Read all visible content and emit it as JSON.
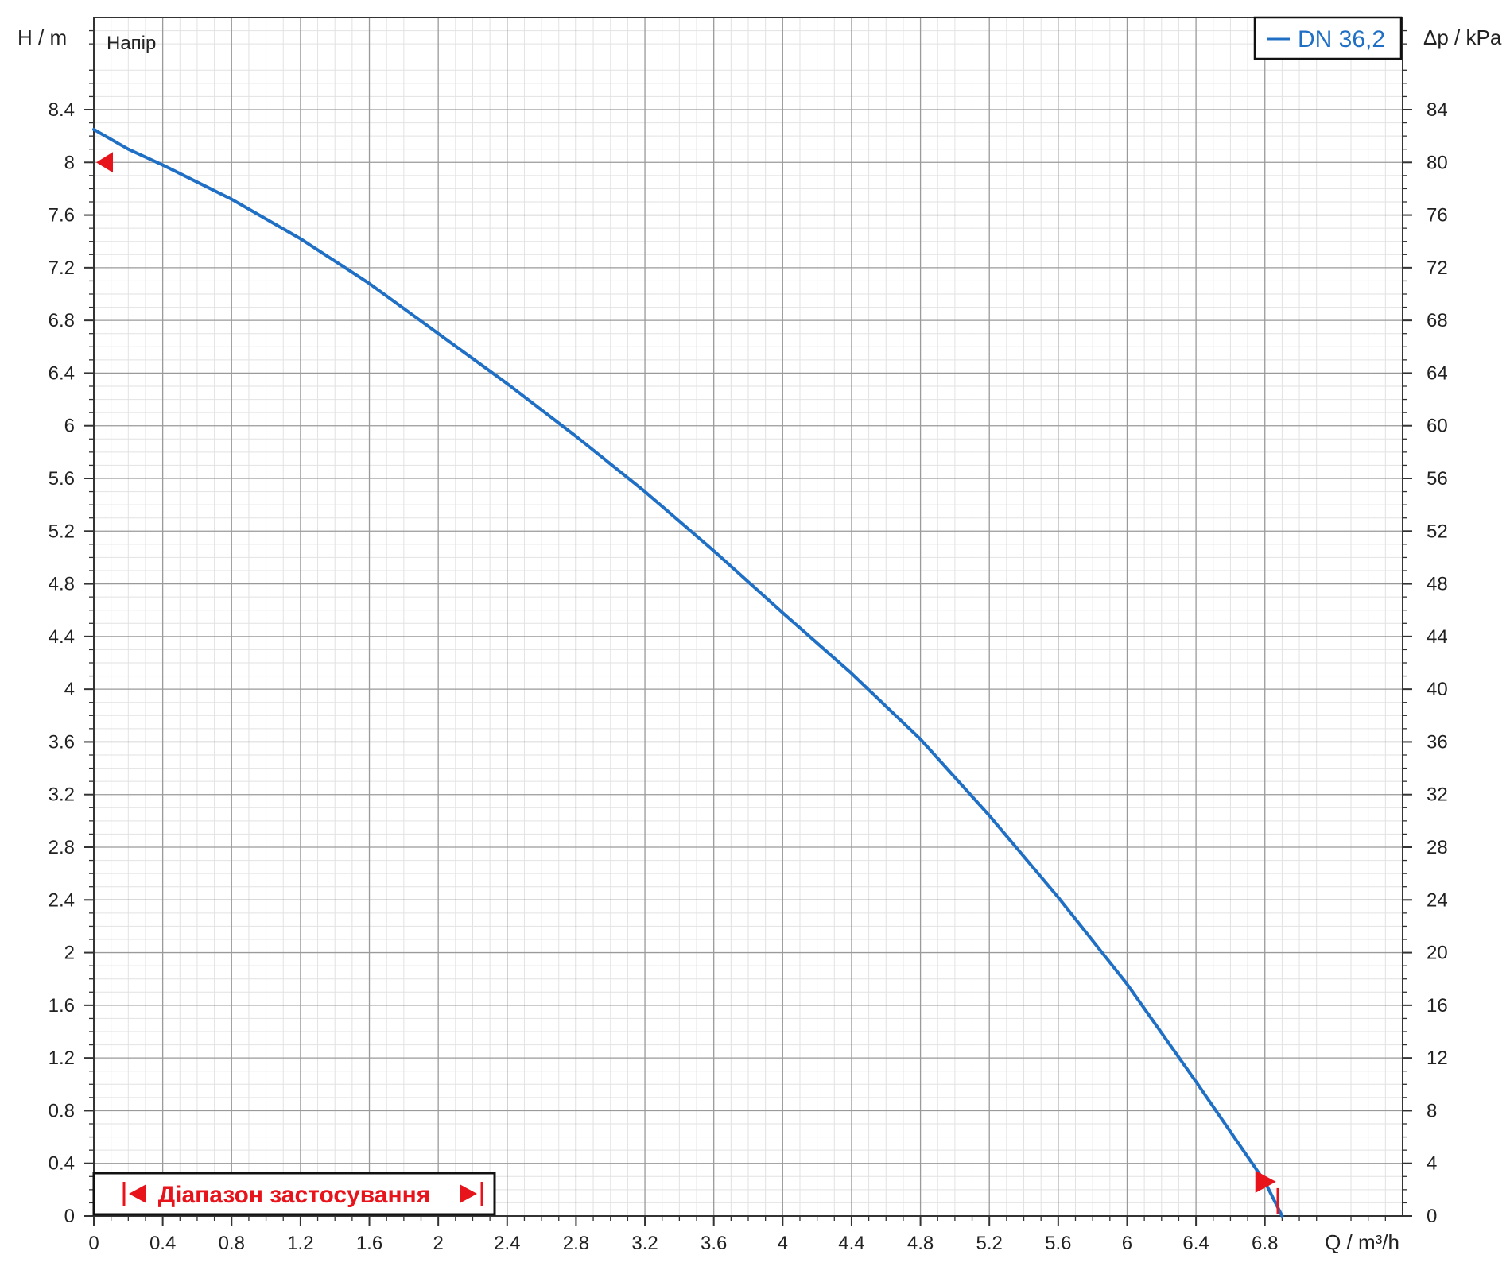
{
  "chart_data": {
    "type": "line",
    "title": "Напір",
    "xlabel": "Q / m³/h",
    "ylabel": "H / m",
    "y2label": "Δp / kPa",
    "xlim": [
      0,
      7.6
    ],
    "ylim": [
      0,
      9.1
    ],
    "y2lim": [
      0,
      91
    ],
    "x_ticks": [
      "0",
      "0.4",
      "0.8",
      "1.2",
      "1.6",
      "2",
      "2.4",
      "2.8",
      "3.2",
      "3.6",
      "4",
      "4.4",
      "4.8",
      "5.2",
      "5.6",
      "6",
      "6.4",
      "6.8"
    ],
    "y_ticks": [
      "0",
      "0.4",
      "0.8",
      "1.2",
      "1.6",
      "2",
      "2.4",
      "2.8",
      "3.2",
      "3.6",
      "4",
      "4.4",
      "4.8",
      "5.2",
      "5.6",
      "6",
      "6.4",
      "6.8",
      "7.2",
      "7.6",
      "8",
      "8.4"
    ],
    "y2_ticks": [
      "0",
      "4",
      "8",
      "12",
      "16",
      "20",
      "24",
      "28",
      "32",
      "36",
      "40",
      "44",
      "48",
      "52",
      "56",
      "60",
      "64",
      "68",
      "72",
      "76",
      "80",
      "84"
    ],
    "grid": true,
    "legend_position": "top-right",
    "series": [
      {
        "name": "DN 36,2",
        "color": "#1f6fc5",
        "x": [
          0,
          0.2,
          0.4,
          0.8,
          1.2,
          1.6,
          2.0,
          2.4,
          2.8,
          3.2,
          3.6,
          4.0,
          4.4,
          4.8,
          5.2,
          5.6,
          6.0,
          6.4,
          6.8,
          6.9
        ],
        "y": [
          8.25,
          8.1,
          7.98,
          7.72,
          7.42,
          7.08,
          6.7,
          6.32,
          5.92,
          5.5,
          5.05,
          4.58,
          4.12,
          3.62,
          3.04,
          2.42,
          1.76,
          1.02,
          0.26,
          0.0
        ]
      }
    ],
    "markers": [
      {
        "x": 0.0,
        "y": 8.0,
        "color": "#e8141c"
      },
      {
        "x": 6.8,
        "y": 0.26,
        "color": "#e8141c"
      }
    ],
    "annotation": {
      "text": "Діапазон застосування",
      "color": "#e8141c"
    }
  }
}
